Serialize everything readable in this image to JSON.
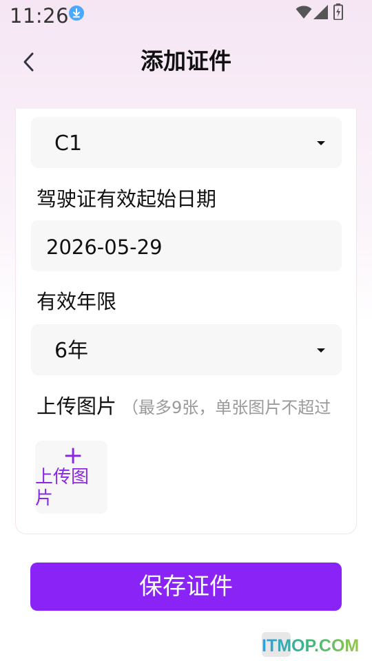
{
  "status_bar": {
    "time": "11:26",
    "icons": [
      "download-icon",
      "wifi-icon",
      "signal-icon",
      "battery-icon"
    ]
  },
  "header": {
    "title": "添加证件",
    "back_icon": "chevron-left-icon"
  },
  "form": {
    "license_class": {
      "value": "C1"
    },
    "start_date": {
      "label": "驾驶证有效起始日期",
      "value": "2026-05-29"
    },
    "validity": {
      "label": "有效年限",
      "value": "6年"
    },
    "upload": {
      "label": "上传图片",
      "hint": "（最多9张，单张图片不超过",
      "plus": "+",
      "button_label": "上传图片"
    }
  },
  "save_button": {
    "label": "保存证件"
  },
  "watermark": {
    "text": "ITMOP.COM"
  },
  "colors": {
    "accent": "#8a23f5",
    "accent_text": "#8b28e6",
    "field_bg": "#f7f7f7",
    "status_icon": "#4aa8ff"
  }
}
